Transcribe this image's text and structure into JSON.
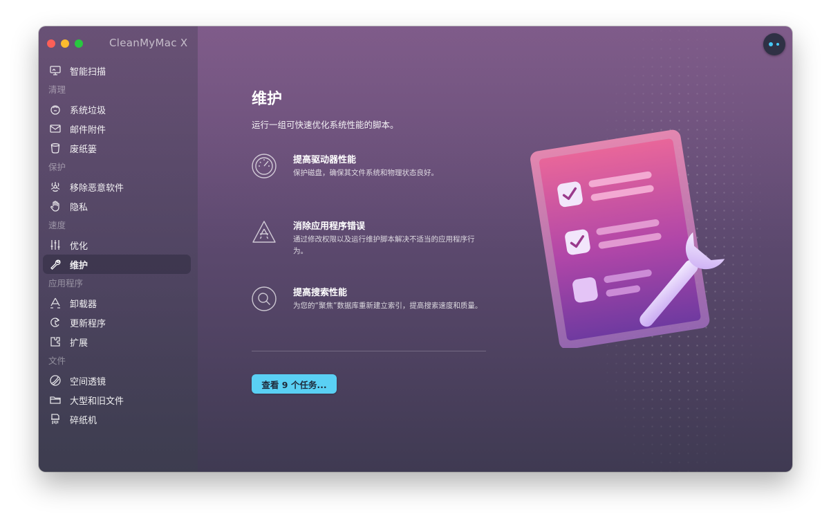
{
  "window": {
    "app_title": "CleanMyMac X"
  },
  "sidebar": {
    "top_item": {
      "label": "智能扫描",
      "icon": "monitor-icon"
    },
    "sections": [
      {
        "title": "清理",
        "items": [
          {
            "label": "系统垃圾",
            "icon": "trash-bin-icon"
          },
          {
            "label": "邮件附件",
            "icon": "mail-icon"
          },
          {
            "label": "废纸篓",
            "icon": "bin-icon"
          }
        ]
      },
      {
        "title": "保护",
        "items": [
          {
            "label": "移除恶意软件",
            "icon": "biohazard-icon"
          },
          {
            "label": "隐私",
            "icon": "hand-icon"
          }
        ]
      },
      {
        "title": "速度",
        "items": [
          {
            "label": "优化",
            "icon": "sliders-icon"
          },
          {
            "label": "维护",
            "icon": "wrench-icon",
            "active": true
          }
        ]
      },
      {
        "title": "应用程序",
        "items": [
          {
            "label": "卸载器",
            "icon": "uninstaller-icon"
          },
          {
            "label": "更新程序",
            "icon": "updater-icon"
          },
          {
            "label": "扩展",
            "icon": "extensions-icon"
          }
        ]
      },
      {
        "title": "文件",
        "items": [
          {
            "label": "空间透镜",
            "icon": "space-lens-icon"
          },
          {
            "label": "大型和旧文件",
            "icon": "folder-icon"
          },
          {
            "label": "碎纸机",
            "icon": "shredder-icon"
          }
        ]
      }
    ]
  },
  "main": {
    "title": "维护",
    "subtitle": "运行一组可快速优化系统性能的脚本。",
    "features": [
      {
        "title": "提高驱动器性能",
        "description": "保护磁盘，确保其文件系统和物理状态良好。",
        "icon": "gauge-icon"
      },
      {
        "title": "消除应用程序错误",
        "description": "通过修改权限以及运行维护脚本解决不适当的应用程序行为。",
        "icon": "app-store-triangle-icon"
      },
      {
        "title": "提高搜索性能",
        "description": "为您的“聚焦”数据库重新建立索引，提高搜索速度和质量。",
        "icon": "magnifier-icon"
      }
    ],
    "cta_label": "查看 9 个任务..."
  },
  "colors": {
    "accent": "#5ad0f4",
    "window_top": "#7b5a86",
    "window_bottom": "#3f3a52"
  }
}
